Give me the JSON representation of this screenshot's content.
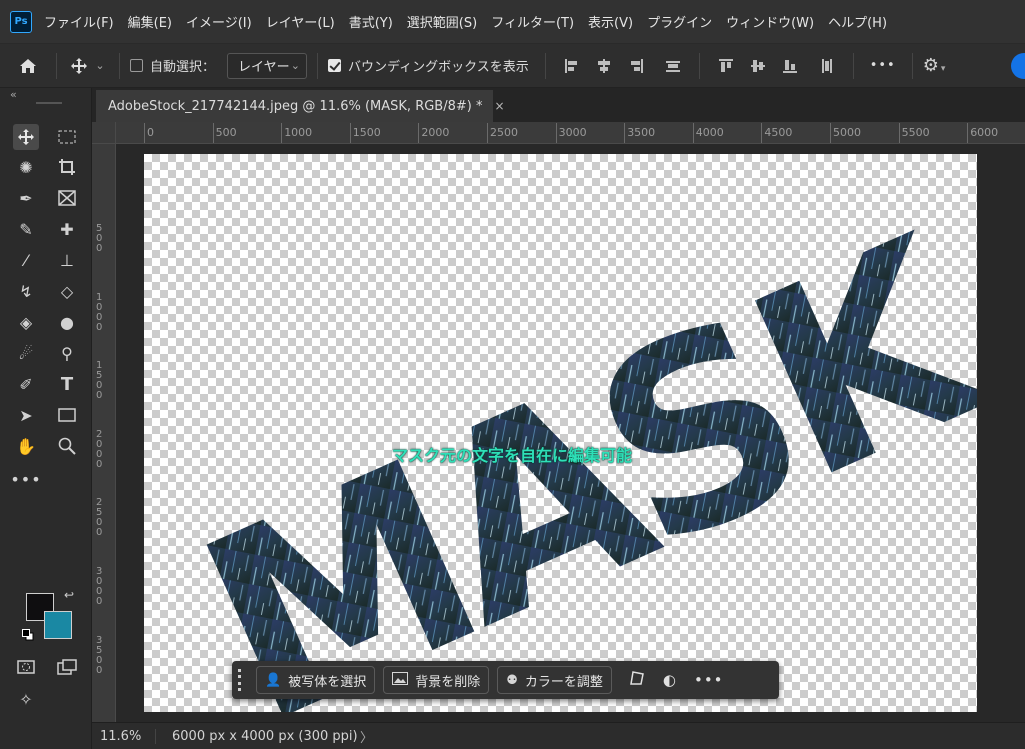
{
  "app": {
    "logo": "Ps"
  },
  "menu": [
    "ファイル(F)",
    "編集(E)",
    "イメージ(I)",
    "レイヤー(L)",
    "書式(Y)",
    "選択範囲(S)",
    "フィルター(T)",
    "表示(V)",
    "プラグイン",
    "ウィンドウ(W)",
    "ヘルプ(H)"
  ],
  "options": {
    "home_icon": "home-icon",
    "move_icon": "move-icon",
    "auto_select_label": "自動選択：",
    "auto_select_checked": false,
    "auto_select_target": "レイヤー",
    "bounding_box_label": "バウンディングボックスを表示",
    "bounding_box_checked": true,
    "more_label": "•••"
  },
  "document": {
    "tab_title": "AdobeStock_217742144.jpeg @ 11.6% (MASK, RGB/8#) *",
    "close_glyph": "×"
  },
  "ruler": {
    "h_labels": [
      "0",
      "500",
      "1000",
      "1500",
      "2000",
      "2500",
      "3000",
      "3500",
      "4000",
      "4500",
      "5000",
      "5500",
      "6000"
    ],
    "v_labels": [
      "5 0 0",
      "1 0 0 0",
      "1 5 0 0",
      "2 0 0 0",
      "2 5 0 0",
      "3 0 0 0",
      "3 5 0 0"
    ]
  },
  "canvas": {
    "mask_text": "MASK",
    "caption": "マスク元の文字を自在に編集可能",
    "caption_color": "#2ee0b8"
  },
  "taskbar": {
    "select_subject": "被写体を選択",
    "remove_background": "背景を削除",
    "adjust_color": "カラーを調整",
    "more": "•••"
  },
  "colors": {
    "foreground": "#0f0e10",
    "background": "#1a88a3"
  },
  "status": {
    "zoom": "11.6%",
    "doc_info": "6000 px x 4000 px (300 ppi)",
    "arrow": "〉"
  }
}
